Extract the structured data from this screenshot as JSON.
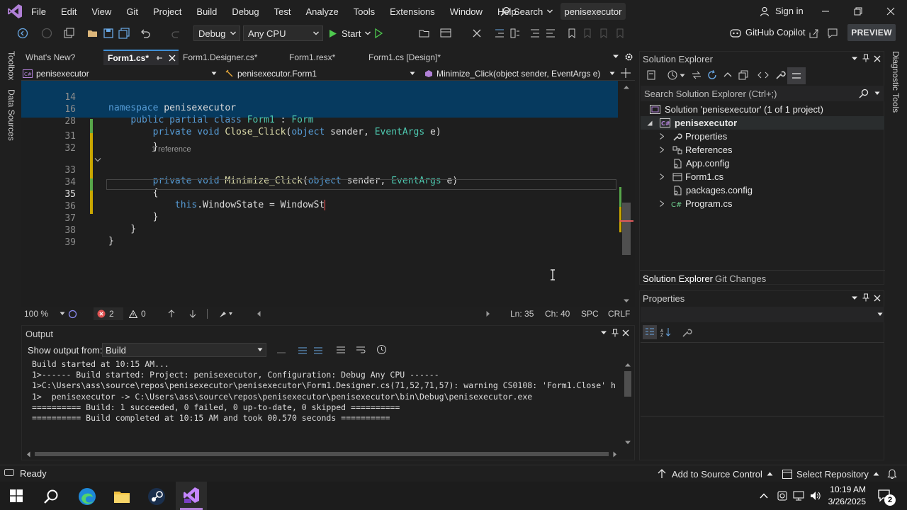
{
  "menu": [
    "File",
    "Edit",
    "View",
    "Git",
    "Project",
    "Build",
    "Debug",
    "Test",
    "Analyze",
    "Tools",
    "Extensions",
    "Window",
    "Help"
  ],
  "search_label": "Search",
  "solution_badge": "penisexecutor",
  "signin": "Sign in",
  "toolbar": {
    "config": "Debug",
    "platform": "Any CPU",
    "start": "Start",
    "copilot": "GitHub Copilot",
    "preview": "PREVIEW"
  },
  "left_strip": [
    "Toolbox",
    "Data Sources"
  ],
  "right_strip": [
    "Diagnostic Tools"
  ],
  "tabs": [
    {
      "label": "What's New?"
    },
    {
      "label": "Form1.cs*"
    },
    {
      "label": "Form1.Designer.cs*"
    },
    {
      "label": "Form1.resx*"
    },
    {
      "label": "Form1.cs [Design]*"
    }
  ],
  "nav": {
    "project": "penisexecutor",
    "class": "penisexecutor.Form1",
    "member": "Minimize_Click(object sender, EventArgs e)"
  },
  "editor": {
    "sticky": [
      {
        "num": "14",
        "code": "namespace penisexecutor"
      },
      {
        "num": "16",
        "code": "    public partial class Form1 : Form"
      },
      {
        "num": "28",
        "code": "        private void Close_Click(object sender, EventArgs e)"
      }
    ],
    "lines": [
      {
        "num": "31",
        "code": "        }"
      },
      {
        "num": "32",
        "code": ""
      },
      {
        "num": "33",
        "code": "        private void Minimize_Click(object sender, EventArgs e)"
      },
      {
        "num": "34",
        "code": "        {"
      },
      {
        "num": "35",
        "code": "            this.WindowState = WindowSt"
      },
      {
        "num": "36",
        "code": "        }"
      },
      {
        "num": "37",
        "code": "    }"
      },
      {
        "num": "38",
        "code": "}"
      },
      {
        "num": "39",
        "code": ""
      }
    ],
    "reference_label": "1 reference"
  },
  "edstatus": {
    "zoom": "100 %",
    "errors": "2",
    "warnings": "0",
    "ln": "Ln: 35",
    "ch": "Ch: 40",
    "spc": "SPC",
    "crlf": "CRLF"
  },
  "output": {
    "title": "Output",
    "show_from_label": "Show output from:",
    "source": "Build",
    "lines": [
      "Build started at 10:15 AM...",
      "1>------ Build started: Project: penisexecutor, Configuration: Debug Any CPU ------",
      "1>C:\\Users\\ass\\source\\repos\\penisexecutor\\penisexecutor\\Form1.Designer.cs(71,52,71,57): warning CS0108: 'Form1.Close' h",
      "1>  penisexecutor -> C:\\Users\\ass\\source\\repos\\penisexecutor\\penisexecutor\\bin\\Debug\\penisexecutor.exe",
      "========== Build: 1 succeeded, 0 failed, 0 up-to-date, 0 skipped ==========",
      "========== Build completed at 10:15 AM and took 00.570 seconds =========="
    ]
  },
  "solution_explorer": {
    "title": "Solution Explorer",
    "search_placeholder": "Search Solution Explorer (Ctrl+;)",
    "solution": "Solution 'penisexecutor' (1 of 1 project)",
    "project": "penisexecutor",
    "items": [
      "Properties",
      "References",
      "App.config",
      "Form1.cs",
      "packages.config",
      "Program.cs"
    ],
    "tabs": [
      "Solution Explorer",
      "Git Changes"
    ]
  },
  "properties": {
    "title": "Properties"
  },
  "statusbar": {
    "ready": "Ready",
    "add_source": "Add to Source Control",
    "select_repo": "Select Repository"
  },
  "taskbar": {
    "time": "10:19 AM",
    "date": "3/26/2025",
    "notif_count": "2"
  }
}
